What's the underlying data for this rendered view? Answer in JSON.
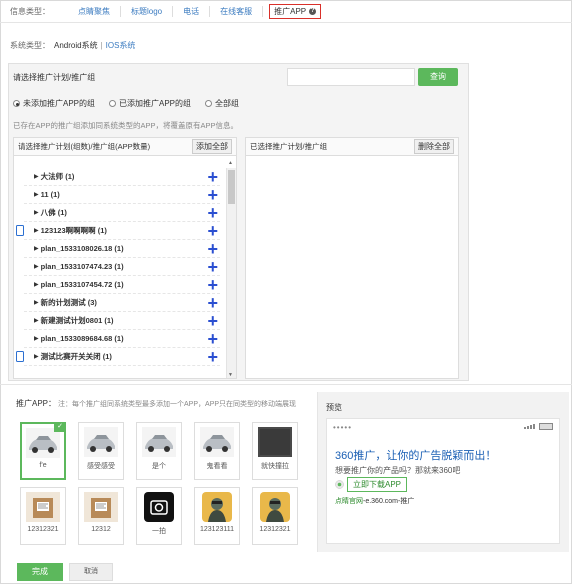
{
  "info": {
    "label": "信息类型：",
    "tabs": [
      "点睛聚焦",
      "标题logo",
      "电话",
      "在线客服"
    ],
    "active_tab": "推广APP"
  },
  "system": {
    "label": "系统类型：",
    "option_android": "Android系统",
    "separator": "|",
    "option_ios": "IOS系统"
  },
  "selector": {
    "title": "请选择推广计划/推广组",
    "search_placeholder": "",
    "query_button": "查询",
    "radios": [
      {
        "label": "未添加推广APP的组",
        "checked": true
      },
      {
        "label": "已添加推广APP的组",
        "checked": false
      },
      {
        "label": "全部组",
        "checked": false
      }
    ],
    "hint": "已存在APP的推广组添加同系统类型的APP，将覆盖原有APP信息。",
    "left_header": "请选择推广计划(组数)/推广组(APP数量)",
    "add_all_button": "添加全部",
    "right_header": "已选择推广计划/推广组",
    "remove_all_button": "删除全部",
    "items": [
      {
        "label": "大法师 (1)",
        "phone": false
      },
      {
        "label": "11 (1)",
        "phone": false
      },
      {
        "label": "八佛 (1)",
        "phone": false
      },
      {
        "label": "123123啊啊啊啊 (1)",
        "phone": true
      },
      {
        "label": "plan_1533108026.18 (1)",
        "phone": false
      },
      {
        "label": "plan_1533107474.23 (1)",
        "phone": false
      },
      {
        "label": "plan_1533107454.72 (1)",
        "phone": false
      },
      {
        "label": "新的计划测试 (3)",
        "phone": false
      },
      {
        "label": "新建测试计划0801 (1)",
        "phone": false
      },
      {
        "label": "plan_1533089684.68 (1)",
        "phone": false
      },
      {
        "label": "测试比赛开关关闭 (1)",
        "phone": true
      }
    ]
  },
  "apps": {
    "title": "推广APP：",
    "note": "注：每个推广组同系统类型最多添加一个APP，APP只在同类型的移动端展现",
    "cards": [
      {
        "name": "f'e",
        "kind": "car",
        "selected": true
      },
      {
        "name": "感受感受",
        "kind": "car",
        "selected": false
      },
      {
        "name": "是个",
        "kind": "car",
        "selected": false
      },
      {
        "name": "鬼看看",
        "kind": "car",
        "selected": false
      },
      {
        "name": "就快撞拉",
        "kind": "dark",
        "selected": false
      },
      {
        "name": "12312321",
        "kind": "box",
        "selected": false
      },
      {
        "name": "12312",
        "kind": "box",
        "selected": false
      },
      {
        "name": "一拍",
        "kind": "camera",
        "selected": false
      },
      {
        "name": "123123111",
        "kind": "game",
        "selected": false
      },
      {
        "name": "12312321",
        "kind": "game",
        "selected": false
      }
    ]
  },
  "preview": {
    "title": "预览",
    "status_dots": "•••••",
    "headline": "360推广，让你的广告脱颖而出！",
    "desc": "想要推广你的产品吗？那就来360吧",
    "download": "立即下载APP",
    "source_name": "点睛官网",
    "source_rest": "-e.360.com-推广"
  },
  "footer": {
    "done": "完成",
    "cancel": "取消"
  },
  "colors": {
    "accent_green": "#5cb85c",
    "link_blue": "#3b7bc0",
    "plus_blue": "#2b4fd1",
    "active_border": "#d9302a"
  }
}
